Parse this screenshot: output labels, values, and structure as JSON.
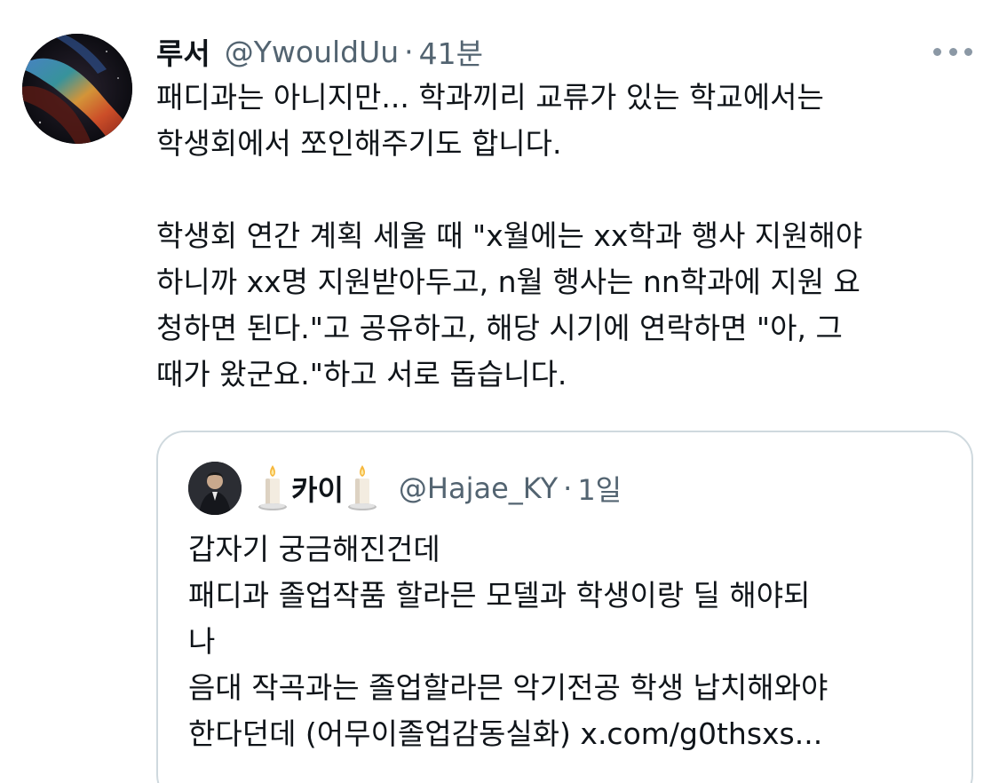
{
  "tweet": {
    "display_name": "루서",
    "handle": "@YwouldUu",
    "separator": "·",
    "time": "41분",
    "text": "패디과는 아니지만... 학과끼리 교류가 있는 학교에서는\n학생회에서 쪼인해주기도 합니다.\n\n학생회 연간 계획 세울 때 \"x월에는 xx학과 행사 지원해야\n하니까 xx명 지원받아두고, n월 행사는 nn학과에 지원 요\n청하면 된다.\"고 공유하고, 해당 시기에 연락하면 \"아, 그\n때가 왔군요.\"하고 서로 돕습니다.",
    "avatar_icon": "galaxy-avatar",
    "more_icon": "more-dots-icon"
  },
  "quoted_tweet": {
    "display_name": "카이",
    "handle": "@Hajae_KY",
    "separator": "·",
    "time": "1일",
    "name_decoration_icon": "candle-icon",
    "text": "갑자기 궁금해진건데\n패디과 졸업작품 할라믄 모델과 학생이랑 딜 해야되\n나\n음대 작곡과는 졸업할라믄 악기전공 학생 납치해와야\n한다던데 (어무이졸업감동실화) x.com/g0thsxs..."
  },
  "colors": {
    "primary_text": "#0f1419",
    "secondary_text": "#536471",
    "border": "#cfd9de",
    "background": "#ffffff"
  }
}
